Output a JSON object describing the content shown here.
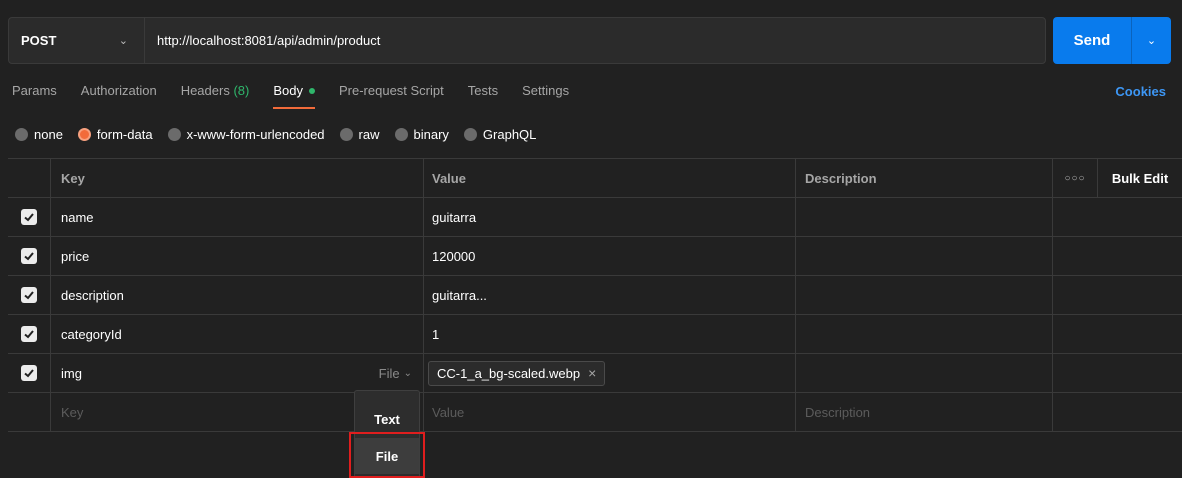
{
  "request": {
    "method": "POST",
    "url": "http://localhost:8081/api/admin/product",
    "send_label": "Send"
  },
  "tabs": [
    {
      "label": "Params"
    },
    {
      "label": "Authorization"
    },
    {
      "label": "Headers",
      "count": "(8)"
    },
    {
      "label": "Body",
      "active": true
    },
    {
      "label": "Pre-request Script"
    },
    {
      "label": "Tests"
    },
    {
      "label": "Settings"
    }
  ],
  "cookies_label": "Cookies",
  "body_types": [
    {
      "label": "none",
      "selected": false
    },
    {
      "label": "form-data",
      "selected": true
    },
    {
      "label": "x-www-form-urlencoded",
      "selected": false
    },
    {
      "label": "raw",
      "selected": false
    },
    {
      "label": "binary",
      "selected": false
    },
    {
      "label": "GraphQL",
      "selected": false
    }
  ],
  "table": {
    "headers": {
      "key": "Key",
      "value": "Value",
      "description": "Description",
      "bulk_edit": "Bulk Edit"
    },
    "rows": [
      {
        "key": "name",
        "value": "guitarra",
        "checked": true
      },
      {
        "key": "price",
        "value": "120000",
        "checked": true
      },
      {
        "key": "description",
        "value": "guitarra...",
        "checked": true
      },
      {
        "key": "categoryId",
        "value": "1",
        "checked": true
      },
      {
        "key": "img",
        "type_label": "File",
        "file_name": "CC-1_a_bg-scaled.webp",
        "checked": true
      }
    ],
    "placeholders": {
      "key": "Key",
      "value": "Value",
      "description": "Description"
    }
  },
  "type_dropdown": {
    "options": [
      "Text",
      "File"
    ],
    "highlighted": "File"
  },
  "colors": {
    "accent_orange": "#f26b3a",
    "send_blue": "#097bed",
    "highlight_red": "#e01e1e",
    "green": "#2fb66b"
  }
}
